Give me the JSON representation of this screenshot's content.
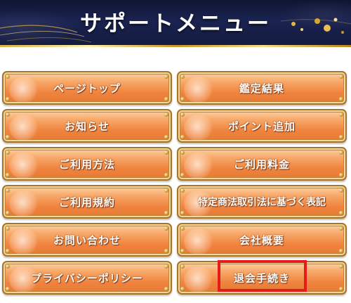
{
  "header": {
    "title": "サポートメニュー"
  },
  "menu": {
    "left": [
      "ページトップ",
      "お知らせ",
      "ご利用方法",
      "ご利用規約",
      "お問い合わせ",
      "プライバシーポリシー"
    ],
    "right": [
      "鑑定結果",
      "ポイント追加",
      "ご利用料金",
      "特定商法取引法に基づく表記",
      "会社概要",
      "退会手続き"
    ]
  },
  "colors": {
    "header_bg": "#141b40",
    "button_orange": "#f0843f",
    "highlight_red": "#e41b1b",
    "gold": "#d9b24a"
  }
}
